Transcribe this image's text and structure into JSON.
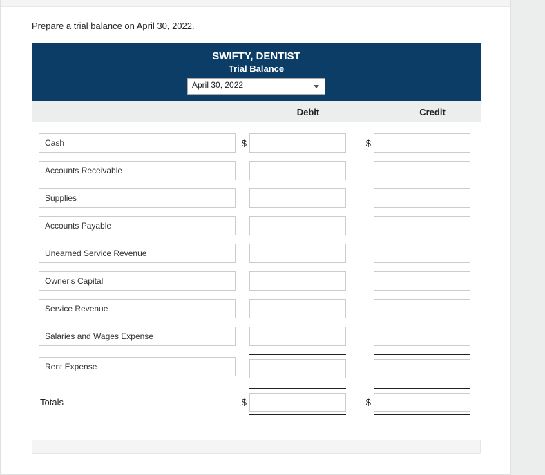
{
  "prompt": "Prepare a trial balance on April 30, 2022.",
  "header": {
    "company": "SWIFTY, DENTIST",
    "title": "Trial Balance",
    "date_selected": "April 30, 2022"
  },
  "columns": {
    "debit": "Debit",
    "credit": "Credit"
  },
  "currency_symbol": "$",
  "accounts": [
    {
      "name": "Cash",
      "debit": "",
      "credit": "",
      "show_symbols": true
    },
    {
      "name": "Accounts Receivable",
      "debit": "",
      "credit": "",
      "show_symbols": false
    },
    {
      "name": "Supplies",
      "debit": "",
      "credit": "",
      "show_symbols": false
    },
    {
      "name": "Accounts Payable",
      "debit": "",
      "credit": "",
      "show_symbols": false
    },
    {
      "name": "Unearned Service Revenue",
      "debit": "",
      "credit": "",
      "show_symbols": false
    },
    {
      "name": "Owner's Capital",
      "debit": "",
      "credit": "",
      "show_symbols": false
    },
    {
      "name": "Service Revenue",
      "debit": "",
      "credit": "",
      "show_symbols": false
    },
    {
      "name": "Salaries and Wages Expense",
      "debit": "",
      "credit": "",
      "show_symbols": false
    },
    {
      "name": "Rent Expense",
      "debit": "",
      "credit": "",
      "show_symbols": false
    }
  ],
  "totals": {
    "label": "Totals",
    "debit": "",
    "credit": ""
  }
}
